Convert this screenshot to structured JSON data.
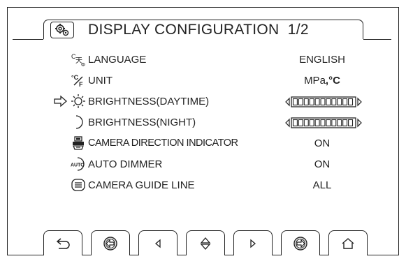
{
  "title": {
    "text": "DISPLAY CONFIGURATION",
    "page": "1/2",
    "icon": "settings-gear-icon"
  },
  "rows": [
    {
      "label": "LANGUAGE",
      "value": "ENGLISH",
      "icon": "language-icon"
    },
    {
      "label": "UNIT",
      "value_unit": "MPa",
      "value_temp": "°C",
      "icon": "unit-icon"
    },
    {
      "label": "BRIGHTNESS(DAYTIME)",
      "icon": "sun-icon",
      "selected": true,
      "level": 1.0
    },
    {
      "label": "BRIGHTNESS(NIGHT)",
      "icon": "moon-icon",
      "level": 1.0
    },
    {
      "label": "CAMERA DIRECTION INDICATOR",
      "value": "ON",
      "icon": "camera-direction-icon"
    },
    {
      "label": "AUTO DIMMER",
      "value": "ON",
      "icon": "auto-dimmer-icon"
    },
    {
      "label": "CAMERA GUIDE LINE",
      "value": "ALL",
      "icon": "camera-guide-line-icon"
    }
  ],
  "buttons": [
    {
      "icon": "return-icon"
    },
    {
      "icon": "previous-page-icon"
    },
    {
      "icon": "left-arrow-icon"
    },
    {
      "icon": "up-down-arrow-icon"
    },
    {
      "icon": "right-arrow-icon"
    },
    {
      "icon": "next-page-icon"
    },
    {
      "icon": "home-icon"
    }
  ],
  "colors": {
    "foreground": "#222222",
    "background": "#ffffff"
  }
}
